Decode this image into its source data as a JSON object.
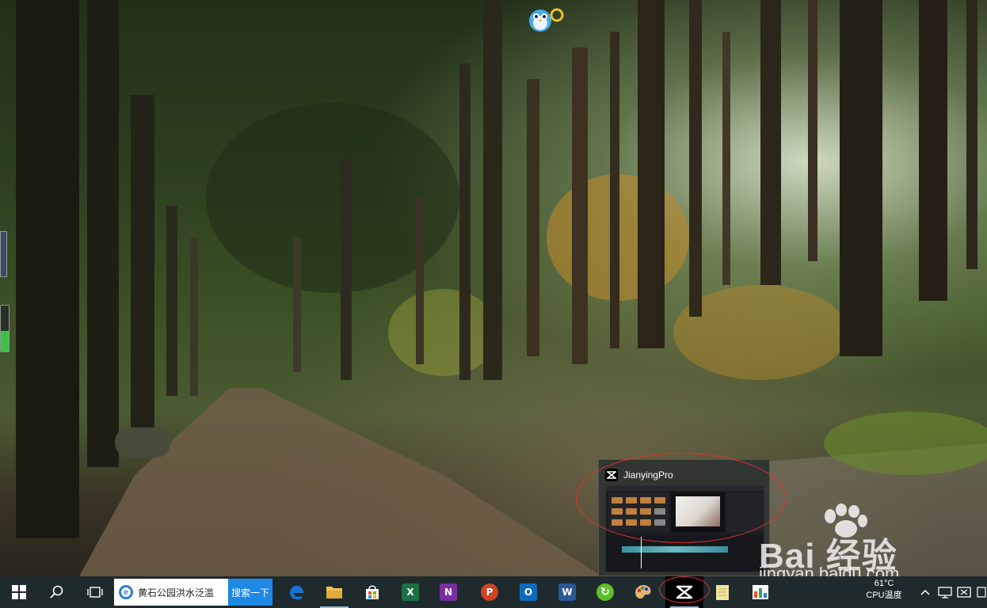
{
  "desktop": {
    "wallpaper": "forest-path-wallpaper",
    "pet_icon": "penguin-pet-icon"
  },
  "gauges": {
    "green_level": 0.45
  },
  "preview": {
    "app_title": "JianyingPro",
    "app_icon": "capcut-icon"
  },
  "watermark": {
    "brand": "Bai 经验",
    "url": "jingyan.baidu.com"
  },
  "taskbar": {
    "start_icon": "windows-start-icon",
    "search_icon": "search-icon",
    "task_view_icon": "task-view-icon",
    "search_box_text": "黄石公园洪水泛滥",
    "search_button_label": "搜索一下",
    "apps": [
      {
        "name": "edge",
        "icon": "edge-icon",
        "glyph": "e",
        "color": "#1a73d2"
      },
      {
        "name": "explorer",
        "icon": "folder-icon",
        "glyph": "",
        "color": "#f2c14e"
      },
      {
        "name": "store",
        "icon": "store-icon",
        "glyph": "",
        "color": "#ffffff"
      },
      {
        "name": "excel",
        "icon": "excel-icon",
        "glyph": "X",
        "color": "#1d7044"
      },
      {
        "name": "onenote",
        "icon": "onenote-icon",
        "glyph": "N",
        "color": "#7a2f9e"
      },
      {
        "name": "powerpoint",
        "icon": "powerpoint-icon",
        "glyph": "P",
        "color": "#d04423"
      },
      {
        "name": "outlook",
        "icon": "outlook-icon",
        "glyph": "O",
        "color": "#0f6cbd"
      },
      {
        "name": "word",
        "icon": "word-icon",
        "glyph": "W",
        "color": "#2b5797"
      },
      {
        "name": "refresh",
        "icon": "green-refresh-icon",
        "glyph": "↻",
        "color": "#5cbf2a"
      },
      {
        "name": "paint",
        "icon": "paint-palette-icon",
        "glyph": "",
        "color": "#d9b27a"
      },
      {
        "name": "jianying",
        "icon": "capcut-icon",
        "glyph": "",
        "color": "#000000"
      },
      {
        "name": "notepad",
        "icon": "notepad-icon",
        "glyph": "",
        "color": "#f1e3a0"
      },
      {
        "name": "monitor",
        "icon": "chart-monitor-icon",
        "glyph": "",
        "color": "#3fa34d"
      }
    ],
    "cpu_temp": "61°C",
    "cpu_label": "CPU温度",
    "tray_icons": [
      "chevron-up-icon",
      "network-icon",
      "notification-icon"
    ]
  }
}
